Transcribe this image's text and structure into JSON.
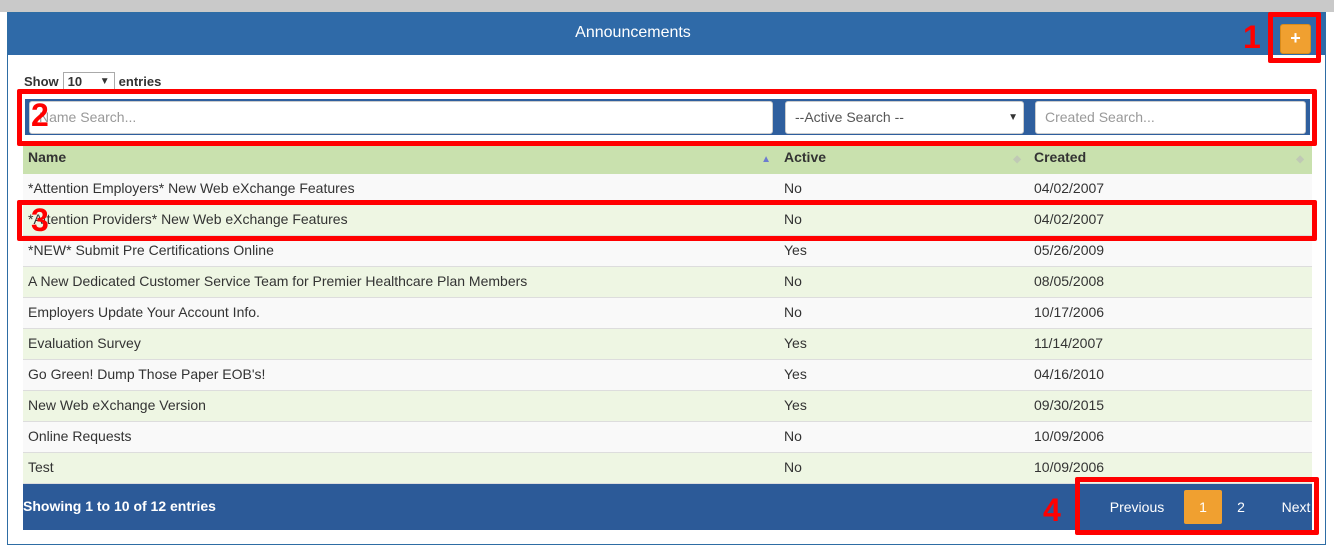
{
  "header": {
    "title": "Announcements",
    "add_button": "+"
  },
  "length": {
    "show": "Show",
    "value": "10",
    "entries": "entries"
  },
  "filters": {
    "name_placeholder": "Name Search...",
    "active_select": "--Active Search --",
    "created_placeholder": "Created Search..."
  },
  "table": {
    "columns": [
      "Name",
      "Active",
      "Created"
    ],
    "rows": [
      {
        "name": "*Attention Employers* New Web eXchange Features",
        "active": "No",
        "created": "04/02/2007"
      },
      {
        "name": "*Attention Providers* New Web eXchange Features",
        "active": "No",
        "created": "04/02/2007"
      },
      {
        "name": "*NEW* Submit Pre Certifications Online",
        "active": "Yes",
        "created": "05/26/2009"
      },
      {
        "name": "A New Dedicated Customer Service Team for Premier Healthcare Plan Members",
        "active": "No",
        "created": "08/05/2008"
      },
      {
        "name": "Employers Update Your Account Info.",
        "active": "No",
        "created": "10/17/2006"
      },
      {
        "name": "Evaluation Survey",
        "active": "Yes",
        "created": "11/14/2007"
      },
      {
        "name": "Go Green! Dump Those Paper EOB's!",
        "active": "Yes",
        "created": "04/16/2010"
      },
      {
        "name": "New Web eXchange Version",
        "active": "Yes",
        "created": "09/30/2015"
      },
      {
        "name": "Online Requests",
        "active": "No",
        "created": "10/09/2006"
      },
      {
        "name": "Test",
        "active": "No",
        "created": "10/09/2006"
      }
    ]
  },
  "footer": {
    "info": "Showing 1 to 10 of 12 entries",
    "previous": "Previous",
    "pages": [
      "1",
      "2"
    ],
    "next": "Next"
  },
  "callouts": [
    "1",
    "2",
    "3",
    "4"
  ],
  "colors": {
    "header": "#2f6aa8",
    "accent": "#f0a030",
    "table_header": "#c9e1ae",
    "callout": "#ff0000"
  }
}
